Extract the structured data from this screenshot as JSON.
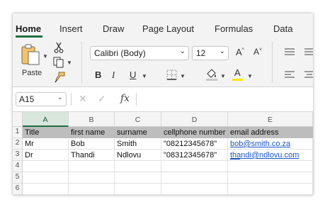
{
  "ribbon_tabs": [
    "Home",
    "Insert",
    "Draw",
    "Page Layout",
    "Formulas",
    "Data"
  ],
  "active_tab": "Home",
  "ribbon": {
    "paste_label": "Paste",
    "font_name": "Calibri (Body)",
    "font_size": "12",
    "bold_label": "B",
    "italic_label": "I",
    "underline_label": "U",
    "grow_font_label": "A^",
    "shrink_font_label": "A˅",
    "font_color_label": "A",
    "font_color": "#ffe600",
    "fill_color": "#c8c8c8"
  },
  "formula_bar": {
    "name_box": "A15",
    "fx_label": "fx",
    "formula": ""
  },
  "grid": {
    "columns": [
      "A",
      "B",
      "C",
      "D",
      "E"
    ],
    "selected_column": "A",
    "rows": [
      {
        "num": "1",
        "cells": [
          "Title",
          "first name",
          "surname",
          "cellphone number",
          "email address"
        ]
      },
      {
        "num": "2",
        "cells": [
          "Mr",
          "Bob",
          "Smith",
          "\"08212345678\"",
          "bob@smith.co.za"
        ]
      },
      {
        "num": "3",
        "cells": [
          "Dr",
          "Thandi",
          "Ndlovu",
          "\"08312345678\"",
          "thandi@ndlovu.com"
        ]
      },
      {
        "num": "4",
        "cells": [
          "",
          "",
          "",
          "",
          ""
        ]
      },
      {
        "num": "5",
        "cells": [
          "",
          "",
          "",
          "",
          ""
        ]
      },
      {
        "num": "6",
        "cells": [
          "",
          "",
          "",
          "",
          ""
        ]
      }
    ]
  },
  "colors": {
    "accent": "#1f7145",
    "header_row_fill": "#bdbdbd",
    "link": "#1a56c7"
  }
}
